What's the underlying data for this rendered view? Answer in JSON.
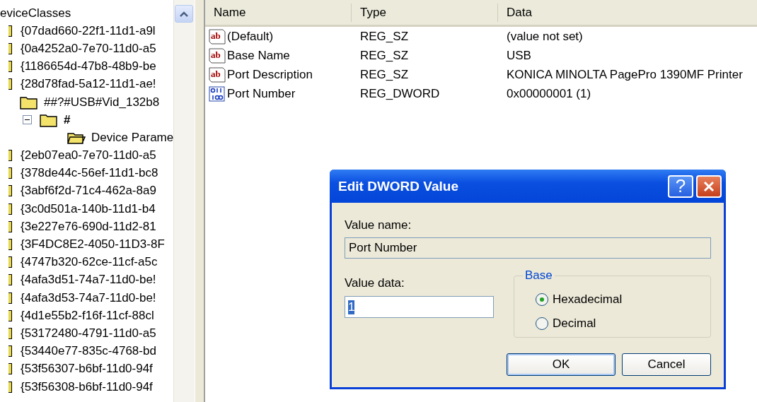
{
  "tree": {
    "label": "eviceClasses",
    "children": [
      {
        "label": "{07dad660-22f1-11d1-a9l"
      },
      {
        "label": "{0a4252a0-7e70-11d0-a5"
      },
      {
        "label": "{1186654d-47b8-48b9-be"
      },
      {
        "label": "{28d78fad-5a12-11d1-ae!",
        "children": [
          {
            "label": "##?#USB#Vid_132b8",
            "children": [
              {
                "label": "#",
                "expanded": true,
                "children": [
                  {
                    "label": "Device Parame",
                    "kind": "open"
                  }
                ]
              }
            ]
          }
        ]
      },
      {
        "label": "{2eb07ea0-7e70-11d0-a5"
      },
      {
        "label": "{378de44c-56ef-11d1-bc8"
      },
      {
        "label": "{3abf6f2d-71c4-462a-8a9"
      },
      {
        "label": "{3c0d501a-140b-11d1-b4"
      },
      {
        "label": "{3e227e76-690d-11d2-81"
      },
      {
        "label": "{3F4DC8E2-4050-11D3-8F"
      },
      {
        "label": "{4747b320-62ce-11cf-a5c"
      },
      {
        "label": "{4afa3d51-74a7-11d0-be!"
      },
      {
        "label": "{4afa3d53-74a7-11d0-be!"
      },
      {
        "label": "{4d1e55b2-f16f-11cf-88cl"
      },
      {
        "label": "{53172480-4791-11d0-a5"
      },
      {
        "label": "{53440e77-835c-4768-bd"
      },
      {
        "label": "{53f56307-b6bf-11d0-94f"
      },
      {
        "label": "{53f56308-b6bf-11d0-94f"
      }
    ]
  },
  "values": {
    "columns": [
      "Name",
      "Type",
      "Data"
    ],
    "rows": [
      {
        "kind": "string",
        "icon": "ab",
        "name": "(Default)",
        "type": "REG_SZ",
        "data": "(value not set)"
      },
      {
        "kind": "string",
        "icon": "ab",
        "name": "Base Name",
        "type": "REG_SZ",
        "data": "USB"
      },
      {
        "kind": "string",
        "icon": "ab",
        "name": "Port Description",
        "type": "REG_SZ",
        "data": "KONICA MINOLTA PagePro 1390MF Printer"
      },
      {
        "kind": "binary",
        "name": "Port Number",
        "type": "REG_DWORD",
        "data": "0x00000001 (1)"
      }
    ]
  },
  "dialog": {
    "title": "Edit DWORD Value",
    "help_button": "?",
    "value_name_label": "Value name:",
    "value_name": "Port Number",
    "value_data_label": "Value data:",
    "value_data": "1",
    "base": {
      "legend": "Base",
      "options": [
        {
          "label": "Hexadecimal",
          "selected": true
        },
        {
          "label": "Decimal",
          "selected": false
        }
      ]
    },
    "buttons": [
      "OK",
      "Cancel"
    ]
  }
}
